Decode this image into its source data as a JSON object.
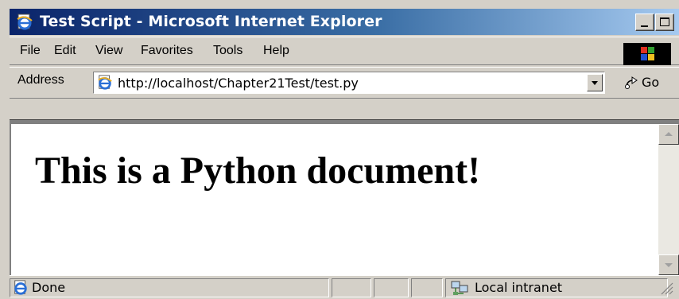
{
  "window": {
    "title": "Test Script - Microsoft Internet Explorer",
    "title_bar_color": "#0a246a"
  },
  "menu": {
    "items": [
      "File",
      "Edit",
      "View",
      "Favorites",
      "Tools",
      "Help"
    ]
  },
  "address_bar": {
    "label": "Address",
    "url": "http://localhost/Chapter21Test/test.py",
    "go_label": "Go"
  },
  "page": {
    "heading": "This is a Python document!"
  },
  "status_bar": {
    "status": "Done",
    "zone": "Local intranet"
  },
  "icons": {
    "title": "ie-page-icon",
    "throbber": "windows-logo-icon",
    "address": "ie-page-icon",
    "go": "go-arrow-icon",
    "zone": "local-intranet-icon"
  }
}
